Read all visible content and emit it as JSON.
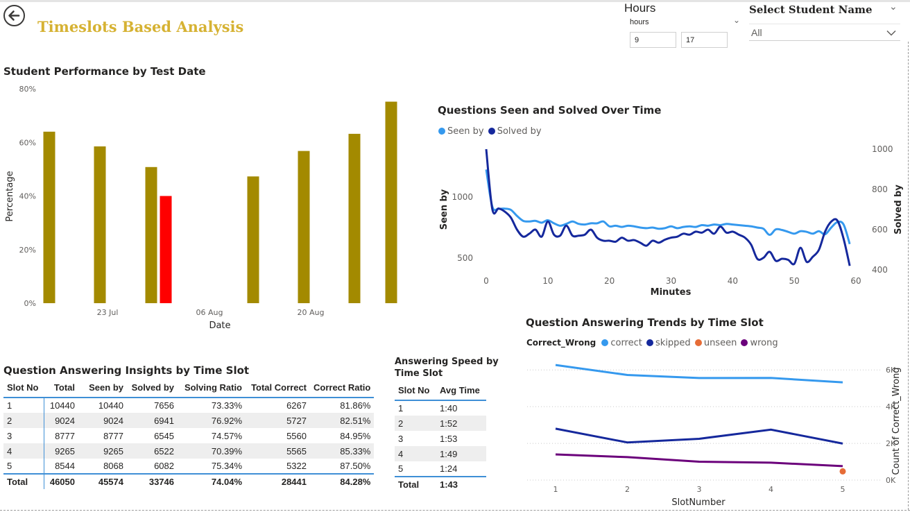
{
  "header": {
    "title": "Timeslots Based Analysis",
    "hours_filter": {
      "title": "Hours",
      "field_label": "hours",
      "min_value": "9",
      "max_value": "17"
    },
    "student_filter": {
      "title": "Select Student Name",
      "selected": "All"
    }
  },
  "colors": {
    "gold": "#a38a00",
    "red": "#ff0000",
    "seen": "#3599ee",
    "solved": "#15289c",
    "correct": "#3599ee",
    "skipped": "#15289c",
    "unseen": "#e66c37",
    "wrong": "#6b007b",
    "title_gold": "#d6b233"
  },
  "icons": {
    "back": "back-arrow-icon",
    "dropdown": "chevron-down-icon"
  },
  "performance_chart": {
    "title": "Student Performance by Test Date",
    "chart_data": {
      "type": "bar",
      "xlabel": "Date",
      "ylabel": "Percentage",
      "ylim": [
        0,
        80
      ],
      "yticks": [
        "0%",
        "20%",
        "40%",
        "60%",
        "80%"
      ],
      "xticks": [
        "23 Jul",
        "06 Aug",
        "20 Aug"
      ],
      "bars": [
        {
          "value": 64,
          "color": "gold"
        },
        {
          "value": 58.5,
          "color": "gold"
        },
        {
          "value": 50.8,
          "color": "gold"
        },
        {
          "value": 40,
          "color": "red"
        },
        {
          "value": 47.3,
          "color": "gold"
        },
        {
          "value": 56.8,
          "color": "gold"
        },
        {
          "value": 63.2,
          "color": "gold"
        },
        {
          "value": 75.2,
          "color": "gold"
        }
      ]
    }
  },
  "seen_solved_chart": {
    "title": "Questions Seen and Solved Over Time",
    "legend": [
      "Seen by",
      "Solved by"
    ],
    "chart_data": {
      "type": "line",
      "xlabel": "Minutes",
      "ylabel_left": "Seen by",
      "ylabel_right": "Solved by",
      "xlim": [
        0,
        60
      ],
      "xticks": [
        "0",
        "10",
        "20",
        "30",
        "40",
        "50",
        "60"
      ],
      "left_ticks": [
        "500",
        "1000"
      ],
      "right_ticks": [
        "400",
        "600",
        "800",
        "1000"
      ],
      "series": [
        {
          "name": "Seen by",
          "axis": "left",
          "x": [
            0,
            1,
            2,
            3,
            4,
            5,
            6,
            7,
            8,
            9,
            10,
            11,
            12,
            13,
            14,
            15,
            16,
            17,
            18,
            19,
            20,
            21,
            22,
            23,
            24,
            25,
            26,
            27,
            28,
            29,
            30,
            31,
            32,
            33,
            34,
            35,
            36,
            37,
            38,
            39,
            40,
            41,
            42,
            43,
            44,
            45,
            46,
            47,
            48,
            49,
            50,
            51,
            52,
            53,
            54,
            55,
            56,
            57,
            58,
            59
          ],
          "y": [
            1225,
            920,
            905,
            905,
            895,
            845,
            805,
            800,
            805,
            790,
            810,
            785,
            765,
            780,
            800,
            780,
            775,
            785,
            785,
            800,
            760,
            765,
            755,
            765,
            760,
            750,
            745,
            750,
            740,
            745,
            760,
            745,
            755,
            760,
            755,
            770,
            765,
            775,
            770,
            780,
            775,
            770,
            765,
            760,
            750,
            740,
            690,
            735,
            730,
            715,
            700,
            720,
            715,
            700,
            720,
            695,
            750,
            795,
            775,
            615
          ]
        },
        {
          "name": "Solved by",
          "axis": "right",
          "x": [
            0,
            1,
            2,
            3,
            4,
            5,
            6,
            7,
            8,
            9,
            10,
            11,
            12,
            13,
            14,
            15,
            16,
            17,
            18,
            19,
            20,
            21,
            22,
            23,
            24,
            25,
            26,
            27,
            28,
            29,
            30,
            31,
            32,
            33,
            34,
            35,
            36,
            37,
            38,
            39,
            40,
            41,
            42,
            43,
            44,
            45,
            46,
            47,
            48,
            49,
            50,
            51,
            52,
            53,
            54,
            55,
            56,
            57,
            58,
            59
          ],
          "y": [
            1000,
            700,
            705,
            690,
            660,
            600,
            565,
            580,
            600,
            565,
            640,
            575,
            570,
            620,
            570,
            570,
            575,
            600,
            560,
            545,
            545,
            540,
            560,
            545,
            548,
            535,
            520,
            545,
            535,
            550,
            560,
            565,
            580,
            575,
            590,
            585,
            600,
            580,
            615,
            585,
            590,
            575,
            560,
            525,
            455,
            460,
            490,
            445,
            455,
            450,
            430,
            510,
            440,
            465,
            500,
            590,
            640,
            645,
            555,
            420
          ]
        }
      ]
    }
  },
  "trend_chart": {
    "title": "Question Answering Trends by Time Slot",
    "legend_title": "Correct_Wrong",
    "legend": [
      "correct",
      "skipped",
      "unseen",
      "wrong"
    ],
    "chart_data": {
      "type": "line",
      "xlabel": "SlotNumber",
      "ylabel": "Count of Correct_Wrong",
      "xticks": [
        "1",
        "2",
        "3",
        "4",
        "5"
      ],
      "yticks": [
        "0K",
        "2K",
        "4K",
        "6K"
      ],
      "ylim": [
        0,
        6500
      ],
      "series": [
        {
          "name": "correct",
          "x": [
            1,
            2,
            3,
            4,
            5
          ],
          "y": [
            6267,
            5727,
            5560,
            5565,
            5322
          ]
        },
        {
          "name": "skipped",
          "x": [
            1,
            2,
            3,
            4,
            5
          ],
          "y": [
            2800,
            2050,
            2250,
            2750,
            1990
          ]
        },
        {
          "name": "unseen",
          "x": [
            5
          ],
          "y": [
            476
          ]
        },
        {
          "name": "wrong",
          "x": [
            1,
            2,
            3,
            4,
            5
          ],
          "y": [
            1400,
            1250,
            1000,
            950,
            760
          ]
        }
      ]
    }
  },
  "insights_table": {
    "title": "Question Answering Insights by Time Slot",
    "columns": [
      "Slot No",
      "Total",
      "Seen by",
      "Solved by",
      "Solving Ratio",
      "Total Correct",
      "Correct Ratio"
    ],
    "rows": [
      [
        "1",
        "10440",
        "10440",
        "7656",
        "73.33%",
        "6267",
        "81.86%"
      ],
      [
        "2",
        "9024",
        "9024",
        "6941",
        "76.92%",
        "5727",
        "82.51%"
      ],
      [
        "3",
        "8777",
        "8777",
        "6545",
        "74.57%",
        "5560",
        "84.95%"
      ],
      [
        "4",
        "9265",
        "9265",
        "6522",
        "70.39%",
        "5565",
        "85.33%"
      ],
      [
        "5",
        "8544",
        "8068",
        "6082",
        "75.34%",
        "5322",
        "87.50%"
      ]
    ],
    "total": [
      "Total",
      "46050",
      "45574",
      "33746",
      "74.04%",
      "28441",
      "84.28%"
    ]
  },
  "speed_table": {
    "title": "Answering Speed by Time Slot",
    "columns": [
      "Slot No",
      "Avg Time"
    ],
    "rows": [
      [
        "1",
        "1:40"
      ],
      [
        "2",
        "1:52"
      ],
      [
        "3",
        "1:53"
      ],
      [
        "4",
        "1:49"
      ],
      [
        "5",
        "1:24"
      ]
    ],
    "total": [
      "Total",
      "1:43"
    ]
  }
}
